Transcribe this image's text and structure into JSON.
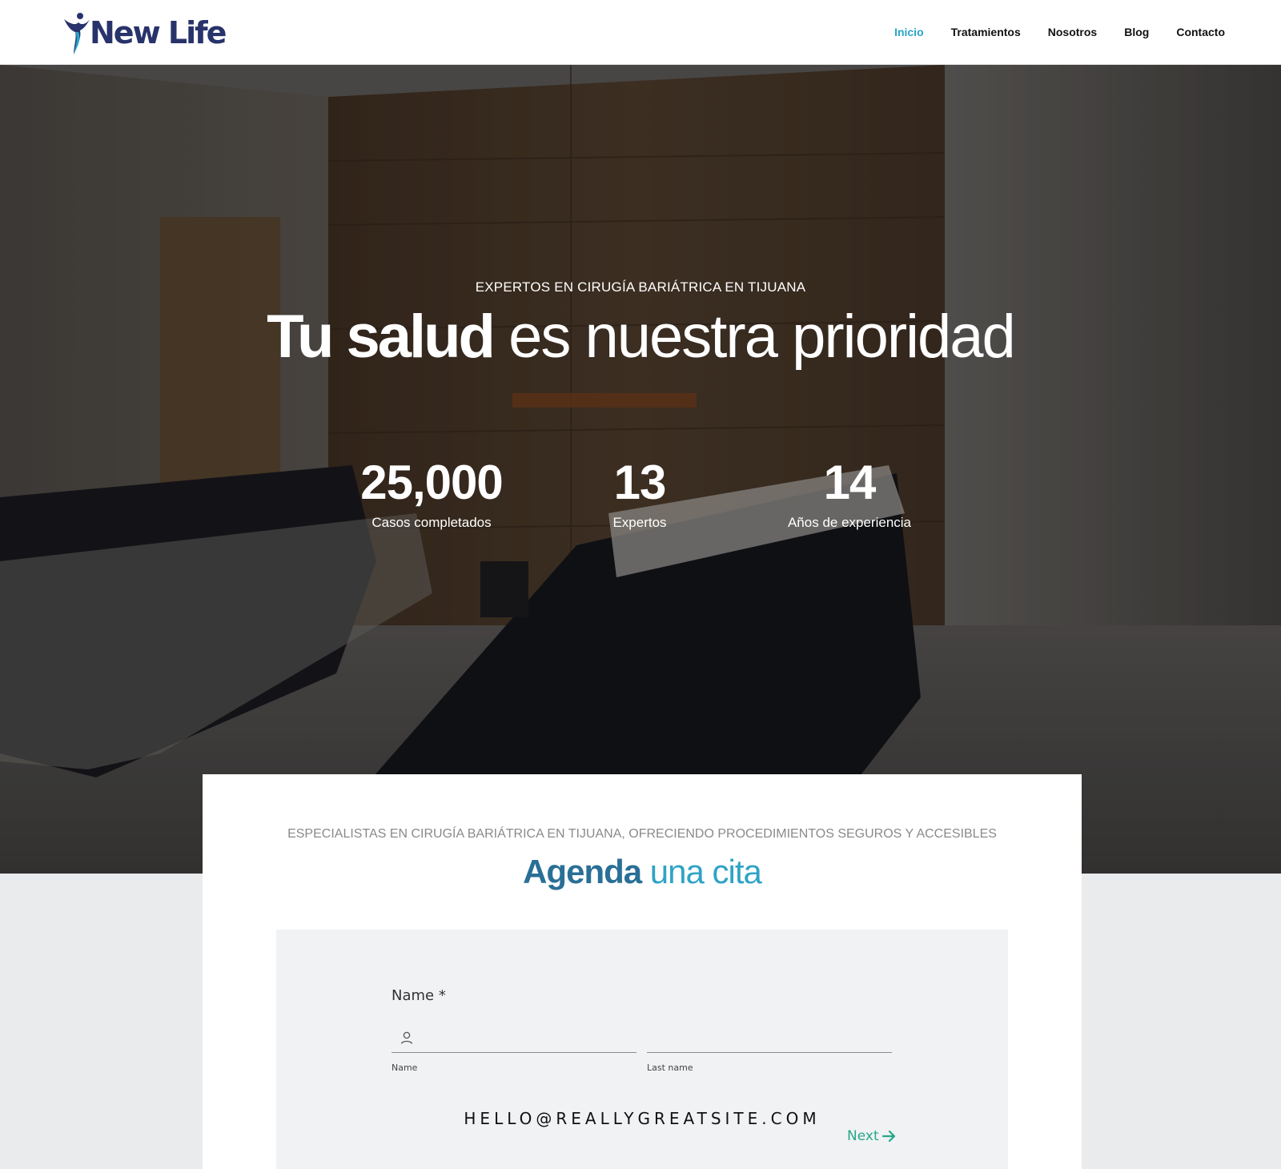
{
  "header": {
    "logo_text": "New Life",
    "nav": [
      {
        "label": "Inicio",
        "active": true
      },
      {
        "label": "Tratamientos",
        "active": false
      },
      {
        "label": "Nosotros",
        "active": false
      },
      {
        "label": "Blog",
        "active": false
      },
      {
        "label": "Contacto",
        "active": false
      }
    ]
  },
  "hero": {
    "kicker": "EXPERTOS EN CIRUGÍA BARIÁTRICA EN TIJUANA",
    "title_bold": "Tu salud",
    "title_light": "es nuestra prioridad",
    "stats": [
      {
        "value": "25,000",
        "label": "Casos completados"
      },
      {
        "value": "13",
        "label": "Expertos"
      },
      {
        "value": "14",
        "label": "Años de experiencia"
      }
    ]
  },
  "appointment": {
    "kicker": "ESPECIALISTAS EN CIRUGÍA BARIÁTRICA EN TIJUANA, OFRECIENDO PROCEDIMIENTOS SEGUROS Y ACCESIBLES",
    "title_bold": "Agenda",
    "title_light": "una cita",
    "form": {
      "name_label": "Name *",
      "first_name": {
        "value": "",
        "sublabel": "Name"
      },
      "last_name": {
        "value": "",
        "sublabel": "Last name"
      },
      "email_text": "HELLO@REALLYGREATSITE.COM",
      "next_label": "Next"
    }
  },
  "colors": {
    "brand_navy": "#28336b",
    "accent_cyan": "#2aa4c8",
    "title_blue": "#2a6f96",
    "next_green": "#28a78a"
  },
  "icons": [
    "new-life-logo-figure",
    "user-icon",
    "arrow-right-icon"
  ]
}
